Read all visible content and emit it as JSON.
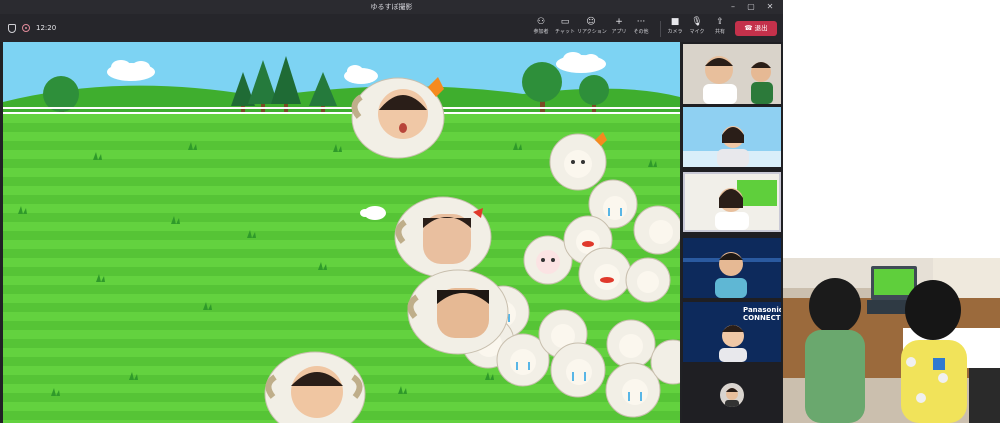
{
  "window": {
    "title": "ゆるすぼ撮影",
    "minimize_icon": "minimize-icon",
    "maximize_icon": "maximize-icon",
    "close_icon": "close-icon"
  },
  "toolbar": {
    "elapsed_time": "12:20",
    "buttons": [
      {
        "label": "参加者",
        "icon": "people-icon"
      },
      {
        "label": "チャット",
        "icon": "chat-icon"
      },
      {
        "label": "リアクション",
        "icon": "reaction-icon"
      },
      {
        "label": "アプリ",
        "icon": "plus-icon"
      },
      {
        "label": "その他",
        "icon": "more-icon"
      },
      {
        "label": "カメラ",
        "icon": "camera-icon"
      },
      {
        "label": "マイク",
        "icon": "mic-icon"
      },
      {
        "label": "共有",
        "icon": "share-icon"
      }
    ],
    "leave_label": "退出"
  },
  "sidebar": {
    "participants": [
      {
        "brand": ""
      },
      {
        "brand": ""
      },
      {
        "brand": ""
      },
      {
        "brand": "Panasonic CONNECT"
      },
      {
        "brand": "Panasonic CONNECT"
      }
    ]
  },
  "colors": {
    "leave": "#c4314b",
    "sky": "#7dd3f3",
    "grass": "#5fcf3c",
    "sheep_wool": "#f2efe6",
    "panasonic_bg": "#0d2a5c"
  }
}
